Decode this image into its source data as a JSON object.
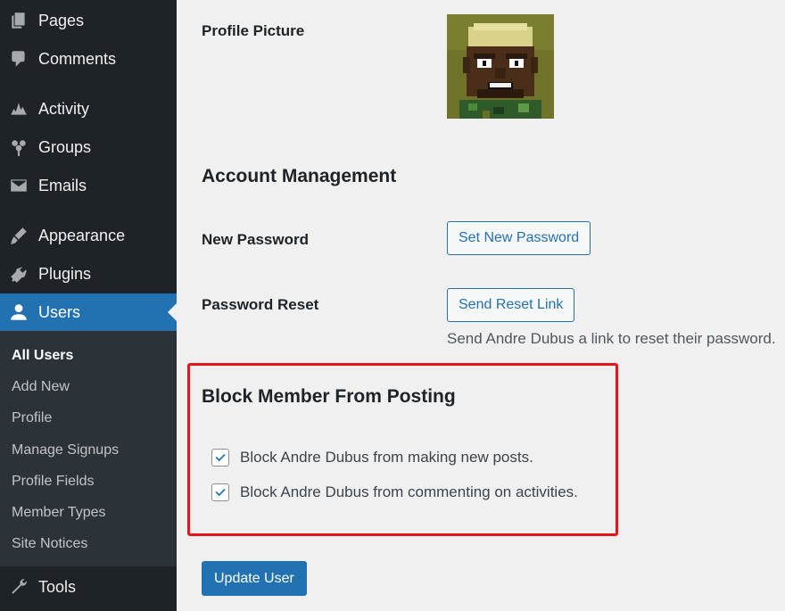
{
  "sidebar": {
    "items": [
      {
        "label": "Pages",
        "icon": "pages-icon"
      },
      {
        "label": "Comments",
        "icon": "comments-icon"
      },
      {
        "label": "Activity",
        "icon": "activity-icon"
      },
      {
        "label": "Groups",
        "icon": "groups-icon"
      },
      {
        "label": "Emails",
        "icon": "emails-icon"
      },
      {
        "label": "Appearance",
        "icon": "appearance-icon"
      },
      {
        "label": "Plugins",
        "icon": "plugins-icon"
      },
      {
        "label": "Users",
        "icon": "users-icon",
        "active": true
      },
      {
        "label": "Tools",
        "icon": "tools-icon"
      }
    ],
    "submenu": [
      {
        "label": "All Users",
        "current": true
      },
      {
        "label": "Add New"
      },
      {
        "label": "Profile"
      },
      {
        "label": "Manage Signups"
      },
      {
        "label": "Profile Fields"
      },
      {
        "label": "Member Types"
      },
      {
        "label": "Site Notices"
      }
    ]
  },
  "profile": {
    "picture_label": "Profile Picture"
  },
  "account": {
    "title": "Account Management",
    "new_password_label": "New Password",
    "set_password_button": "Set New Password",
    "password_reset_label": "Password Reset",
    "send_reset_button": "Send Reset Link",
    "reset_description": "Send Andre Dubus a link to reset their password."
  },
  "block": {
    "title": "Block Member From Posting",
    "options": [
      {
        "label": "Block Andre Dubus from making new posts.",
        "checked": true
      },
      {
        "label": "Block Andre Dubus from commenting on activities.",
        "checked": true
      }
    ]
  },
  "update_button": "Update User",
  "colors": {
    "sidebar_bg": "#1d2327",
    "accent": "#2271b1",
    "highlight": "#e5151d"
  }
}
